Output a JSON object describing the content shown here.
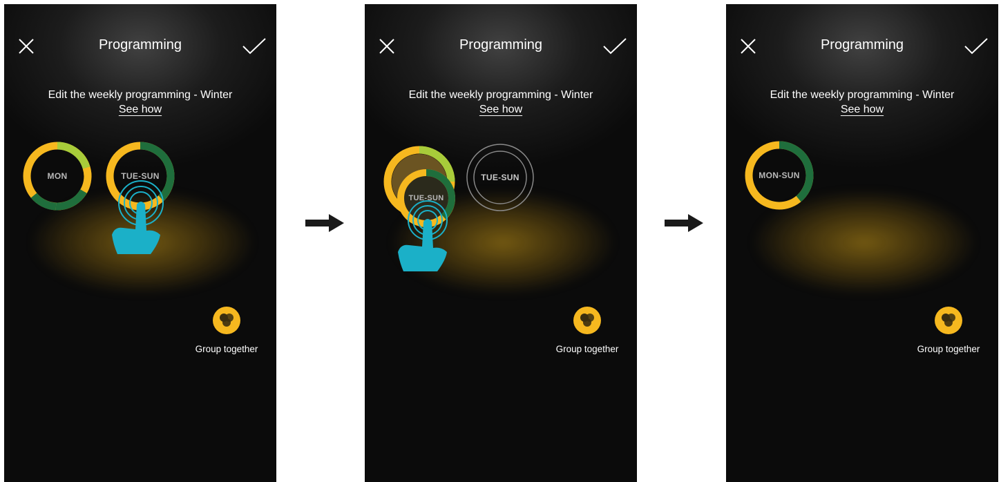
{
  "colors": {
    "yellow": "#f6b81f",
    "dark_green": "#1f6e3c",
    "light_green": "#a8cc3a",
    "hand": "#1bb0c8",
    "screen_bg": "#0b0b0b"
  },
  "icons": {
    "close": "close-icon",
    "confirm": "checkmark-icon",
    "group": "group-circles-icon",
    "touch": "touch-hand-icon",
    "arrow": "arrow-right-icon"
  },
  "screens": [
    {
      "title": "Programming",
      "subtitle": "Edit the weekly programming - Winter",
      "see_how": "See how",
      "days": [
        {
          "label": "MON"
        },
        {
          "label": "TUE-SUN"
        }
      ],
      "group_label": "Group together"
    },
    {
      "title": "Programming",
      "subtitle": "Edit the weekly programming - Winter",
      "see_how": "See how",
      "days": [
        {
          "label": "TUE-SUN"
        },
        {
          "label": "TUE-SUN"
        }
      ],
      "group_label": "Group together"
    },
    {
      "title": "Programming",
      "subtitle": "Edit the weekly programming - Winter",
      "see_how": "See how",
      "days": [
        {
          "label": "MON-SUN"
        }
      ],
      "group_label": "Group together"
    }
  ]
}
